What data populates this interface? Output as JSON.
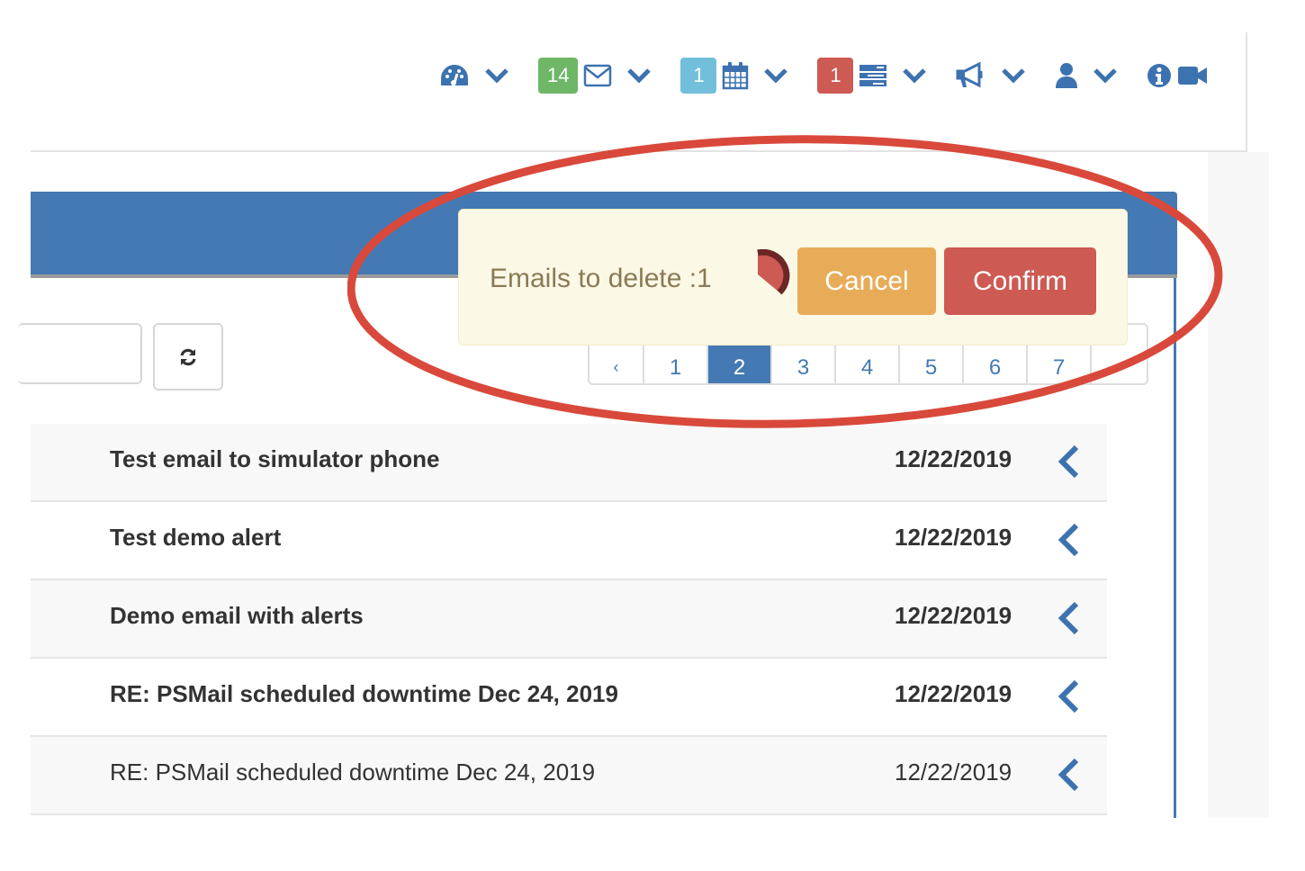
{
  "navbar": {
    "colors": {
      "icon": "#3d72b0",
      "success": "#6db766",
      "info": "#72bfdc",
      "danger": "#cd5a53"
    },
    "groups": [
      {
        "icon": "dashboard-icon",
        "badge": null
      },
      {
        "icon": "envelope-icon",
        "badge": "14",
        "badge_color": "#6db766"
      },
      {
        "icon": "calendar-icon",
        "badge": "1",
        "badge_color": "#72bfdc"
      },
      {
        "icon": "tasks-icon",
        "badge": "1",
        "badge_color": "#cd5a53"
      },
      {
        "icon": "bullhorn-icon",
        "badge": null
      },
      {
        "icon": "user-icon",
        "badge": null
      }
    ],
    "trailing_icons": [
      "info-icon",
      "video-camera-icon"
    ]
  },
  "toolbar": {
    "search_value": "",
    "refresh_icon": "refresh-icon"
  },
  "pagination": {
    "prev": "‹",
    "next": "›",
    "pages": [
      "1",
      "2",
      "3",
      "4",
      "5",
      "6",
      "7"
    ],
    "active": "2"
  },
  "confirm_dialog": {
    "message": "Emails to delete :1",
    "cancel_label": "Cancel",
    "confirm_label": "Confirm",
    "colors": {
      "background": "#fcf8e6",
      "cancel": "#e8ac58",
      "confirm": "#cd5a53"
    }
  },
  "emails": [
    {
      "subject": "Test email to simulator phone",
      "date": "12/22/2019",
      "unread": true
    },
    {
      "subject": "Test demo alert",
      "date": "12/22/2019",
      "unread": true
    },
    {
      "subject": "Demo email with alerts",
      "date": "12/22/2019",
      "unread": true
    },
    {
      "subject": "RE: PSMail scheduled downtime Dec 24, 2019",
      "date": "12/22/2019",
      "unread": true
    },
    {
      "subject": "RE: PSMail scheduled downtime Dec 24, 2019",
      "date": "12/22/2019",
      "unread": false
    }
  ],
  "annotation": {
    "shape": "ellipse",
    "color": "#d9493b"
  }
}
